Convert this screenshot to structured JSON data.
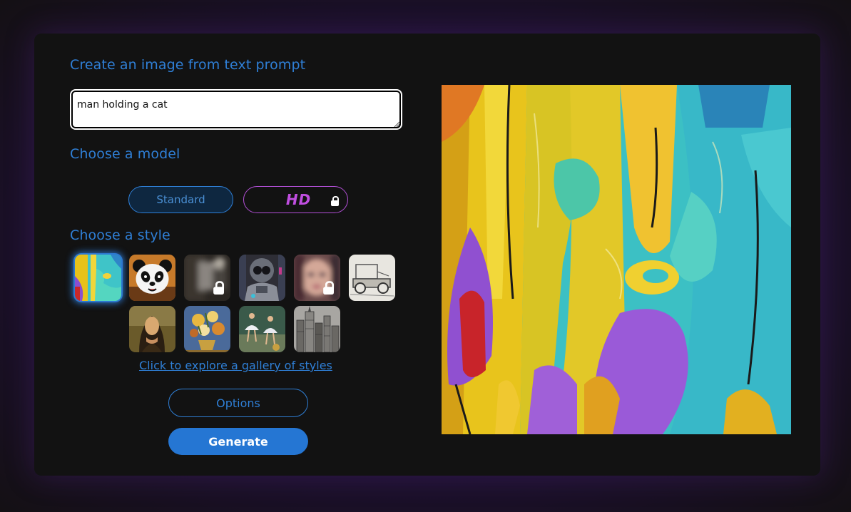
{
  "headings": {
    "prompt": "Create an image from text prompt",
    "model": "Choose a model",
    "style": "Choose a style"
  },
  "prompt": {
    "value": "man holding a cat"
  },
  "models": [
    {
      "label": "Standard",
      "selected": true,
      "locked": false
    },
    {
      "label": "HD",
      "selected": false,
      "locked": true
    }
  ],
  "styles": [
    {
      "name": "abstract-painting",
      "selected": true,
      "locked": false
    },
    {
      "name": "panda",
      "selected": false,
      "locked": false
    },
    {
      "name": "blurred-style",
      "selected": false,
      "locked": true
    },
    {
      "name": "robot",
      "selected": false,
      "locked": false
    },
    {
      "name": "blurred-portrait",
      "selected": false,
      "locked": true
    },
    {
      "name": "pencil-car-sketch",
      "selected": false,
      "locked": false
    },
    {
      "name": "renaissance-portrait",
      "selected": false,
      "locked": false
    },
    {
      "name": "flower-still-life",
      "selected": false,
      "locked": false
    },
    {
      "name": "ballet-dancers",
      "selected": false,
      "locked": false
    },
    {
      "name": "city-sketch",
      "selected": false,
      "locked": false
    }
  ],
  "gallery_link": "Click to explore a gallery of styles",
  "buttons": {
    "options": "Options",
    "generate": "Generate"
  },
  "colors": {
    "accent": "#2f7fd6",
    "hd": "#c04ee0",
    "generate": "#2576d3"
  },
  "icons": {
    "lock": "lock-icon"
  }
}
